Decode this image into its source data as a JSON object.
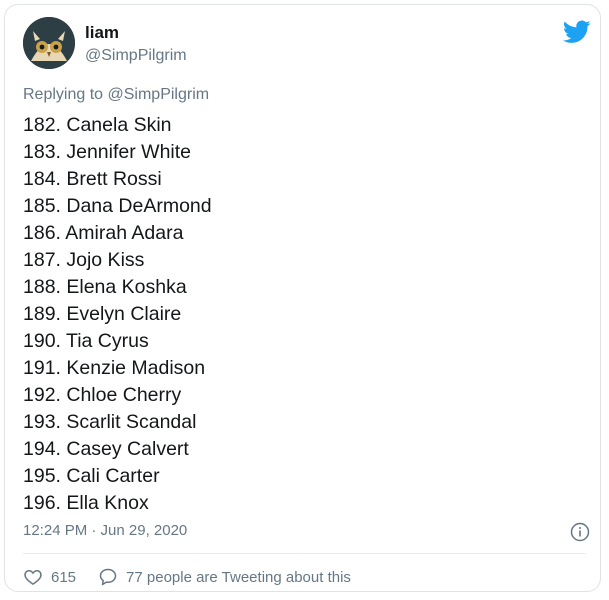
{
  "colors": {
    "twitter_blue": "#1da1f2",
    "text": "#14171a",
    "muted": "#657786",
    "border": "#dfe3e6"
  },
  "tweet": {
    "display_name": "liam",
    "handle": "@SimpPilgrim",
    "replying_to": "Replying to @SimpPilgrim",
    "lines": [
      "182. Canela Skin",
      "183. Jennifer White",
      "184. Brett Rossi",
      "185. Dana DeArmond",
      "186. Amirah Adara",
      "187. Jojo Kiss",
      "188. Elena Koshka",
      "189. Evelyn Claire",
      "190. Tia Cyrus",
      "191. Kenzie Madison",
      "192. Chloe Cherry",
      "193. Scarlit Scandal",
      "194. Casey Calvert",
      "195. Cali Carter",
      "196. Ella Knox"
    ],
    "timestamp": "12:24 PM · Jun 29, 2020",
    "likes": "615",
    "tweeting_about": "77 people are Tweeting about this"
  },
  "icons": {
    "brand": "twitter-bird-icon",
    "info": "info-icon",
    "like": "heart-icon",
    "reply": "speech-bubble-icon"
  }
}
